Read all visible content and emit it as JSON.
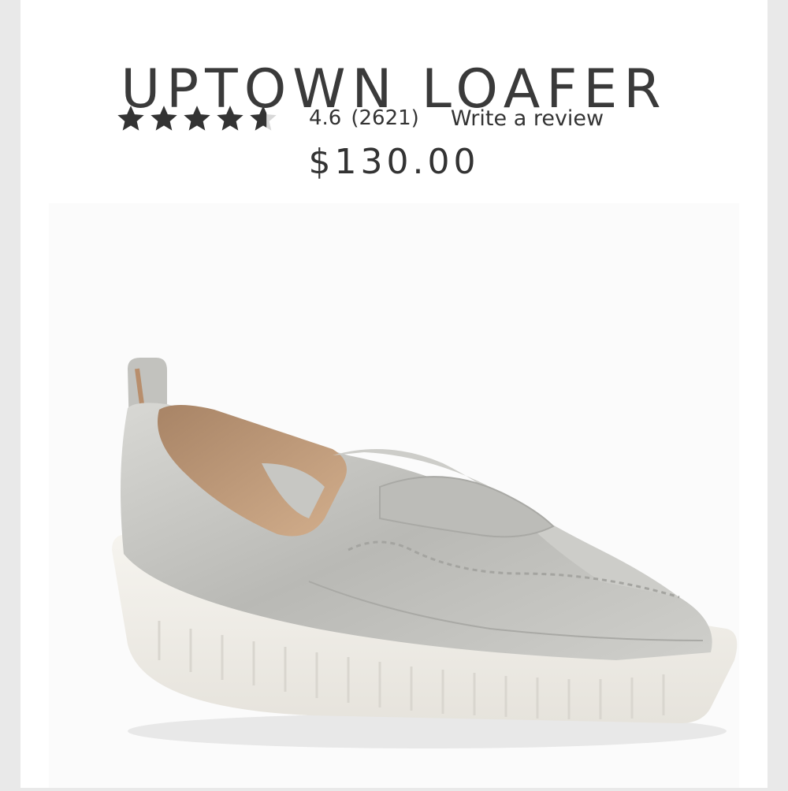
{
  "product": {
    "title": "UPTOWN LOAFER",
    "rating": "4.6",
    "rating_value": 4.6,
    "review_count": "(2621)",
    "write_review_label": "Write a review",
    "price": "$130.00"
  },
  "image": {
    "icon": "silver-loafer-shoe",
    "colors": {
      "upper": "#c4c4c0",
      "lining": "#c9a27f",
      "sole": "#f3f1ec"
    }
  }
}
